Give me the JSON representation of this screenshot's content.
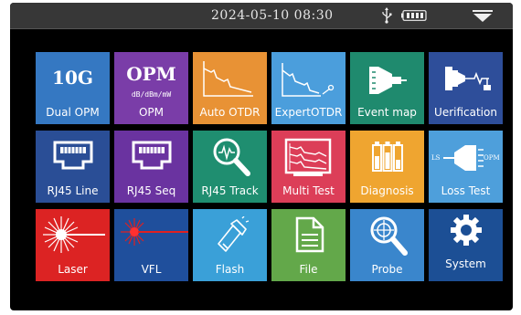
{
  "status_bar": {
    "datetime": "2024-05-10   08:30",
    "usb_icon": "usb-icon",
    "battery_icon": "battery-icon",
    "dropdown_icon": "triangle-down-icon"
  },
  "tiles": [
    {
      "label": "Dual OPM",
      "big": "10G",
      "color": "#3578c2",
      "icon": "10g-text"
    },
    {
      "label": "OPM",
      "big": "OPM",
      "small": "dB/dBm/mW",
      "color": "#7a3da8",
      "icon": "opm-text"
    },
    {
      "label": "Auto OTDR",
      "color": "#e89235",
      "icon": "otdr-trace-icon"
    },
    {
      "label": "ExpertOTDR",
      "color": "#4b9edc",
      "icon": "otdr-trace-cursor-icon"
    },
    {
      "label": "Event map",
      "color": "#1f8a6e",
      "icon": "connector-map-icon"
    },
    {
      "label": "Uerification",
      "color": "#2e4e9a",
      "icon": "fiber-connector-icon"
    },
    {
      "label": "RJ45  Line",
      "color": "#2a4e96",
      "icon": "rj45-port-icon"
    },
    {
      "label": "RJ45  Seq",
      "color": "#6a33a0",
      "icon": "rj45-port-icon"
    },
    {
      "label": "RJ45 Track",
      "color": "#1f8e70",
      "icon": "magnifier-wave-icon"
    },
    {
      "label": "Multi Test",
      "color": "#dc3e58",
      "icon": "multi-trace-screen-icon"
    },
    {
      "label": "Diagnosis",
      "color": "#efa530",
      "icon": "battery-cells-icon"
    },
    {
      "label": "Loss Test",
      "ls": "LS",
      "opm": "OPM",
      "color": "#4e9fdb",
      "icon": "loss-test-icon"
    },
    {
      "label": "Laser",
      "color": "#dc2323",
      "icon": "laser-burst-icon"
    },
    {
      "label": "VFL",
      "color": "#1f4f9c",
      "icon": "red-laser-beam-icon"
    },
    {
      "label": "Flash",
      "color": "#3aa0d8",
      "icon": "flashlight-icon"
    },
    {
      "label": "File",
      "color": "#63a84a",
      "icon": "document-icon"
    },
    {
      "label": "Probe",
      "color": "#3a86cc",
      "icon": "probe-magnifier-icon"
    },
    {
      "label": "System",
      "color": "#1c4f95",
      "icon": "gear-icon"
    }
  ]
}
